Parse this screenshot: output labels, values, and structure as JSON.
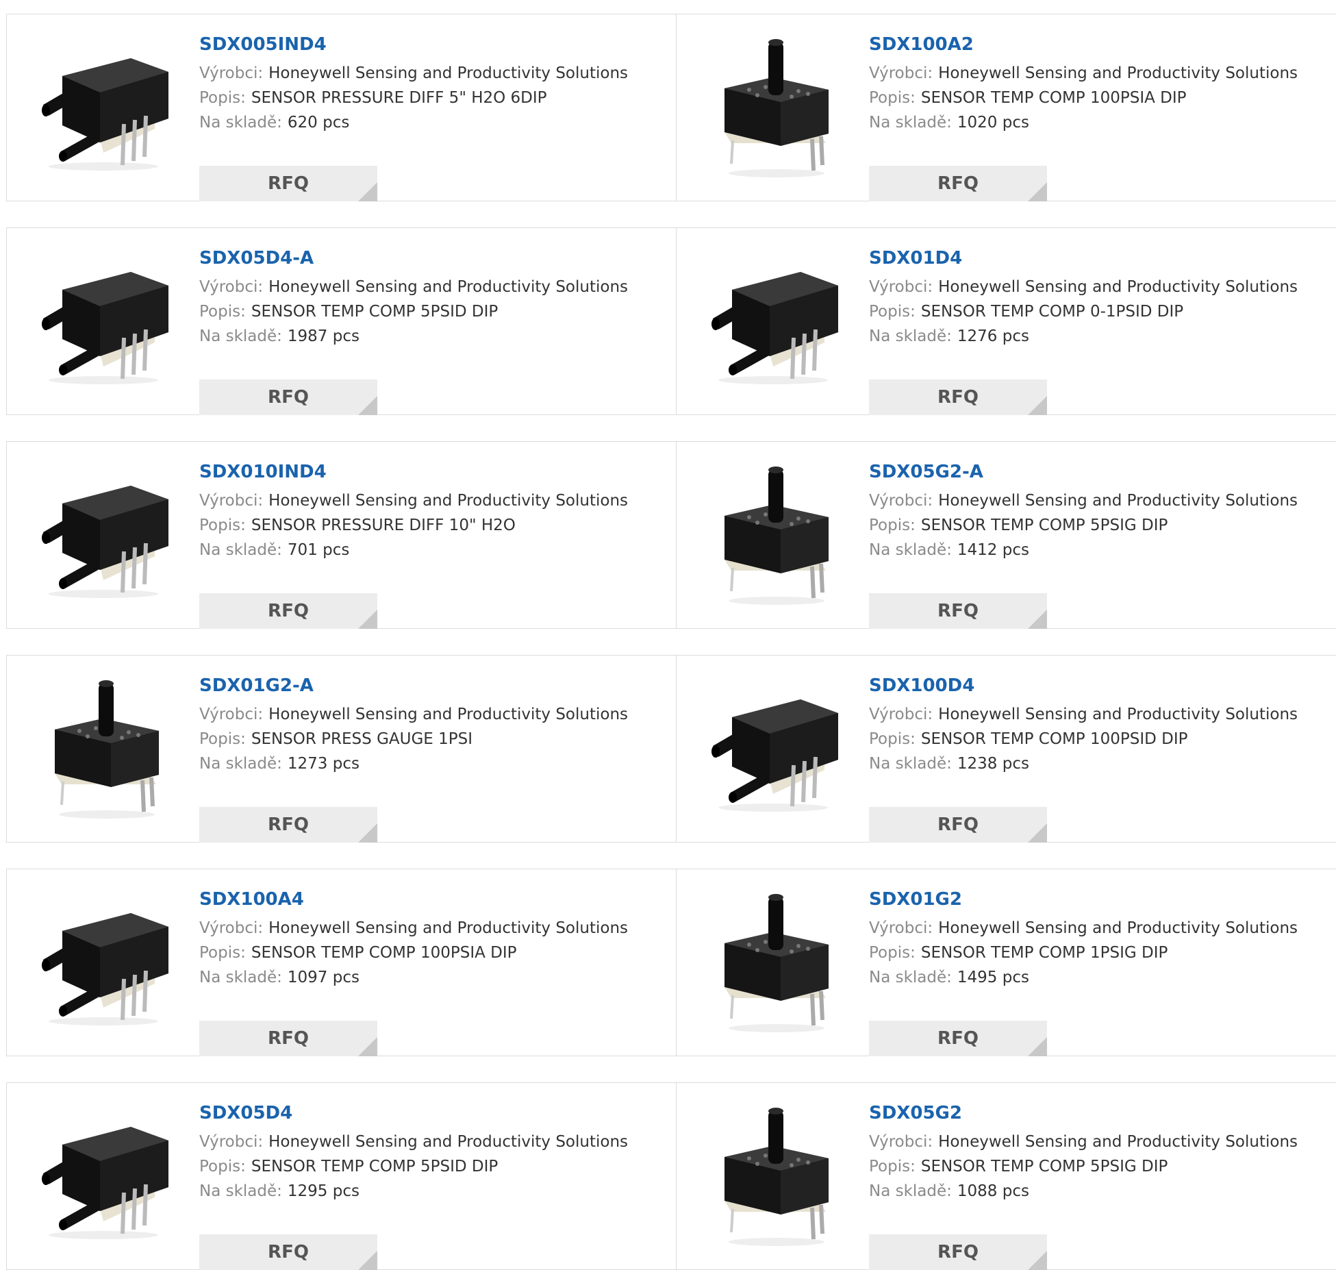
{
  "labels": {
    "manufacturer": "Výrobci:",
    "description": "Popis:",
    "stock": "Na skladě:",
    "rfq": "RFQ"
  },
  "products": [
    {
      "part": "SDX005IND4",
      "manufacturer": "Honeywell Sensing and Productivity Solutions",
      "description": "SENSOR PRESSURE DIFF 5\" H2O 6DIP",
      "stock": "620 pcs",
      "image": "side-port-sensor"
    },
    {
      "part": "SDX100A2",
      "manufacturer": "Honeywell Sensing and Productivity Solutions",
      "description": "SENSOR TEMP COMP 100PSIA DIP",
      "stock": "1020 pcs",
      "image": "top-port-sensor"
    },
    {
      "part": "SDX05D4-A",
      "manufacturer": "Honeywell Sensing and Productivity Solutions",
      "description": "SENSOR TEMP COMP 5PSID DIP",
      "stock": "1987 pcs",
      "image": "side-port-sensor"
    },
    {
      "part": "SDX01D4",
      "manufacturer": "Honeywell Sensing and Productivity Solutions",
      "description": "SENSOR TEMP COMP 0-1PSID DIP",
      "stock": "1276 pcs",
      "image": "side-port-sensor"
    },
    {
      "part": "SDX010IND4",
      "manufacturer": "Honeywell Sensing and Productivity Solutions",
      "description": "SENSOR PRESSURE DIFF 10\" H2O",
      "stock": "701 pcs",
      "image": "side-port-sensor"
    },
    {
      "part": "SDX05G2-A",
      "manufacturer": "Honeywell Sensing and Productivity Solutions",
      "description": "SENSOR TEMP COMP 5PSIG DIP",
      "stock": "1412 pcs",
      "image": "top-port-sensor"
    },
    {
      "part": "SDX01G2-A",
      "manufacturer": "Honeywell Sensing and Productivity Solutions",
      "description": "SENSOR PRESS GAUGE 1PSI",
      "stock": "1273 pcs",
      "image": "top-port-sensor"
    },
    {
      "part": "SDX100D4",
      "manufacturer": "Honeywell Sensing and Productivity Solutions",
      "description": "SENSOR TEMP COMP 100PSID DIP",
      "stock": "1238 pcs",
      "image": "side-port-sensor"
    },
    {
      "part": "SDX100A4",
      "manufacturer": "Honeywell Sensing and Productivity Solutions",
      "description": "SENSOR TEMP COMP 100PSIA DIP",
      "stock": "1097 pcs",
      "image": "side-port-sensor"
    },
    {
      "part": "SDX01G2",
      "manufacturer": "Honeywell Sensing and Productivity Solutions",
      "description": "SENSOR TEMP COMP 1PSIG DIP",
      "stock": "1495 pcs",
      "image": "top-port-sensor"
    },
    {
      "part": "SDX05D4",
      "manufacturer": "Honeywell Sensing and Productivity Solutions",
      "description": "SENSOR TEMP COMP 5PSID DIP",
      "stock": "1295 pcs",
      "image": "side-port-sensor"
    },
    {
      "part": "SDX05G2",
      "manufacturer": "Honeywell Sensing and Productivity Solutions",
      "description": "SENSOR TEMP COMP 5PSIG DIP",
      "stock": "1088 pcs",
      "image": "top-port-sensor"
    }
  ]
}
